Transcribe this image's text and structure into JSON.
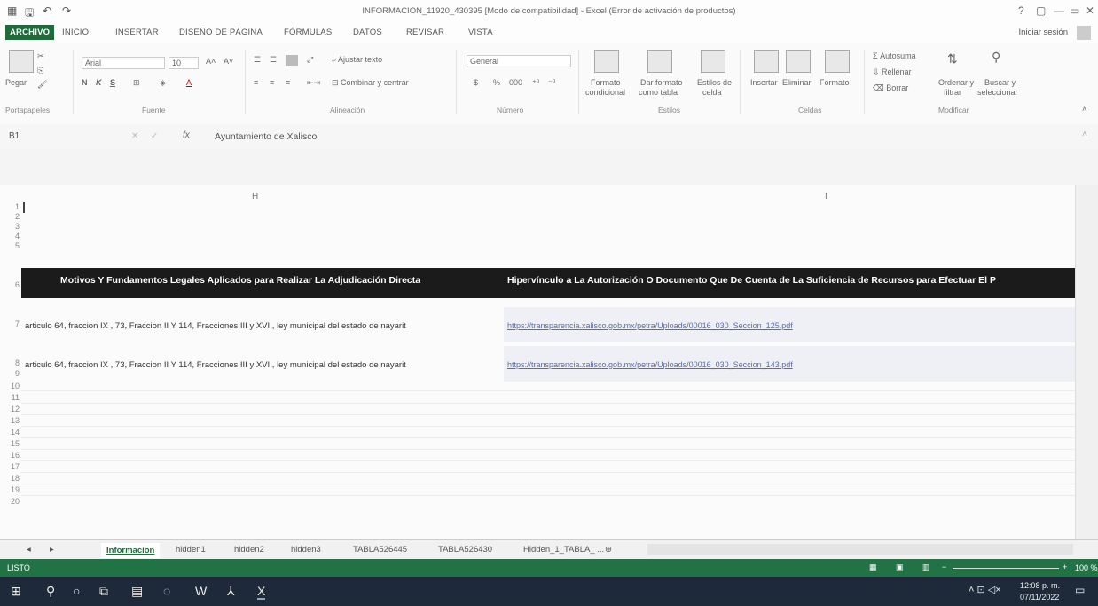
{
  "window": {
    "title": "INFORMACION_11920_430395 [Modo de compatibilidad] - Excel (Error de activación de productos)",
    "controls": [
      "?",
      "▢",
      "—",
      "▭",
      "✕"
    ]
  },
  "ribbon_tabs": {
    "file": "ARCHIVO",
    "items": [
      "INICIO",
      "INSERTAR",
      "DISEÑO DE PÁGINA",
      "FÓRMULAS",
      "DATOS",
      "REVISAR",
      "VISTA"
    ],
    "signin": "Iniciar sesión"
  },
  "ribbon": {
    "paste": "Pegar",
    "font_name": "Arial",
    "font_size": "10",
    "bold": "N",
    "italic": "K",
    "underline": "S",
    "wrap_text": "Ajustar texto",
    "merge_center": "Combinar y centrar",
    "number_format": "General",
    "currency": "$",
    "percent": "%",
    "thousands": "000",
    "cond_format_1": "Formato",
    "cond_format_2": "condicional",
    "table_format_1": "Dar formato",
    "table_format_2": "como tabla",
    "cell_styles_1": "Estilos de",
    "cell_styles_2": "celda",
    "insert": "Insertar",
    "delete": "Eliminar",
    "format": "Formato",
    "autosum": "Autosuma",
    "fill": "Rellenar",
    "clear": "Borrar",
    "sort_1": "Ordenar y",
    "sort_2": "filtrar",
    "find_1": "Buscar y",
    "find_2": "seleccionar",
    "groups": [
      "Portapapeles",
      "Fuente",
      "Alineación",
      "Número",
      "Estilos",
      "Celdas",
      "Modificar"
    ]
  },
  "formula_bar": {
    "name_box": "B1",
    "fx": "fx",
    "value": "Ayuntamiento de Xalisco"
  },
  "grid": {
    "columns": [
      "H",
      "I"
    ],
    "rows": [
      "1",
      "2",
      "3",
      "4",
      "5",
      "6",
      "7",
      "8",
      "9",
      "10",
      "11",
      "12",
      "13",
      "14",
      "15",
      "16",
      "17",
      "18",
      "19",
      "20"
    ],
    "header_h": "Motivos Y Fundamentos Legales Aplicados para Realizar La Adjudicación Directa",
    "header_i": "Hipervínculo a La Autorización O Documento Que De Cuenta de La Suficiencia de Recursos para Efectuar El P",
    "row7_h": "articulo 64, fraccion IX , 73, Fraccion II Y 114, Fracciones III y XVI , ley municipal del estado de nayarit",
    "row7_i": "https://transparencia.xalisco.gob.mx/petra/Uploads/00016_030_Seccion_125.pdf",
    "row8_h": "articulo 64, fraccion IX , 73, Fraccion II Y 114, Fracciones III y XVI , ley municipal del estado de nayarit",
    "row8_i": "https://transparencia.xalisco.gob.mx/petra/Uploads/00016_030_Seccion_143.pdf"
  },
  "sheet_tabs": {
    "active": "Informacion",
    "others": [
      "hidden1",
      "hidden2",
      "hidden3",
      "TABLA526445",
      "TABLA526430",
      "Hidden_1_TABLA_ ..."
    ]
  },
  "status": {
    "ready": "LISTO",
    "zoom": "100 %"
  },
  "taskbar": {
    "time": "12:08 p. m.",
    "date": "07/11/2022"
  }
}
